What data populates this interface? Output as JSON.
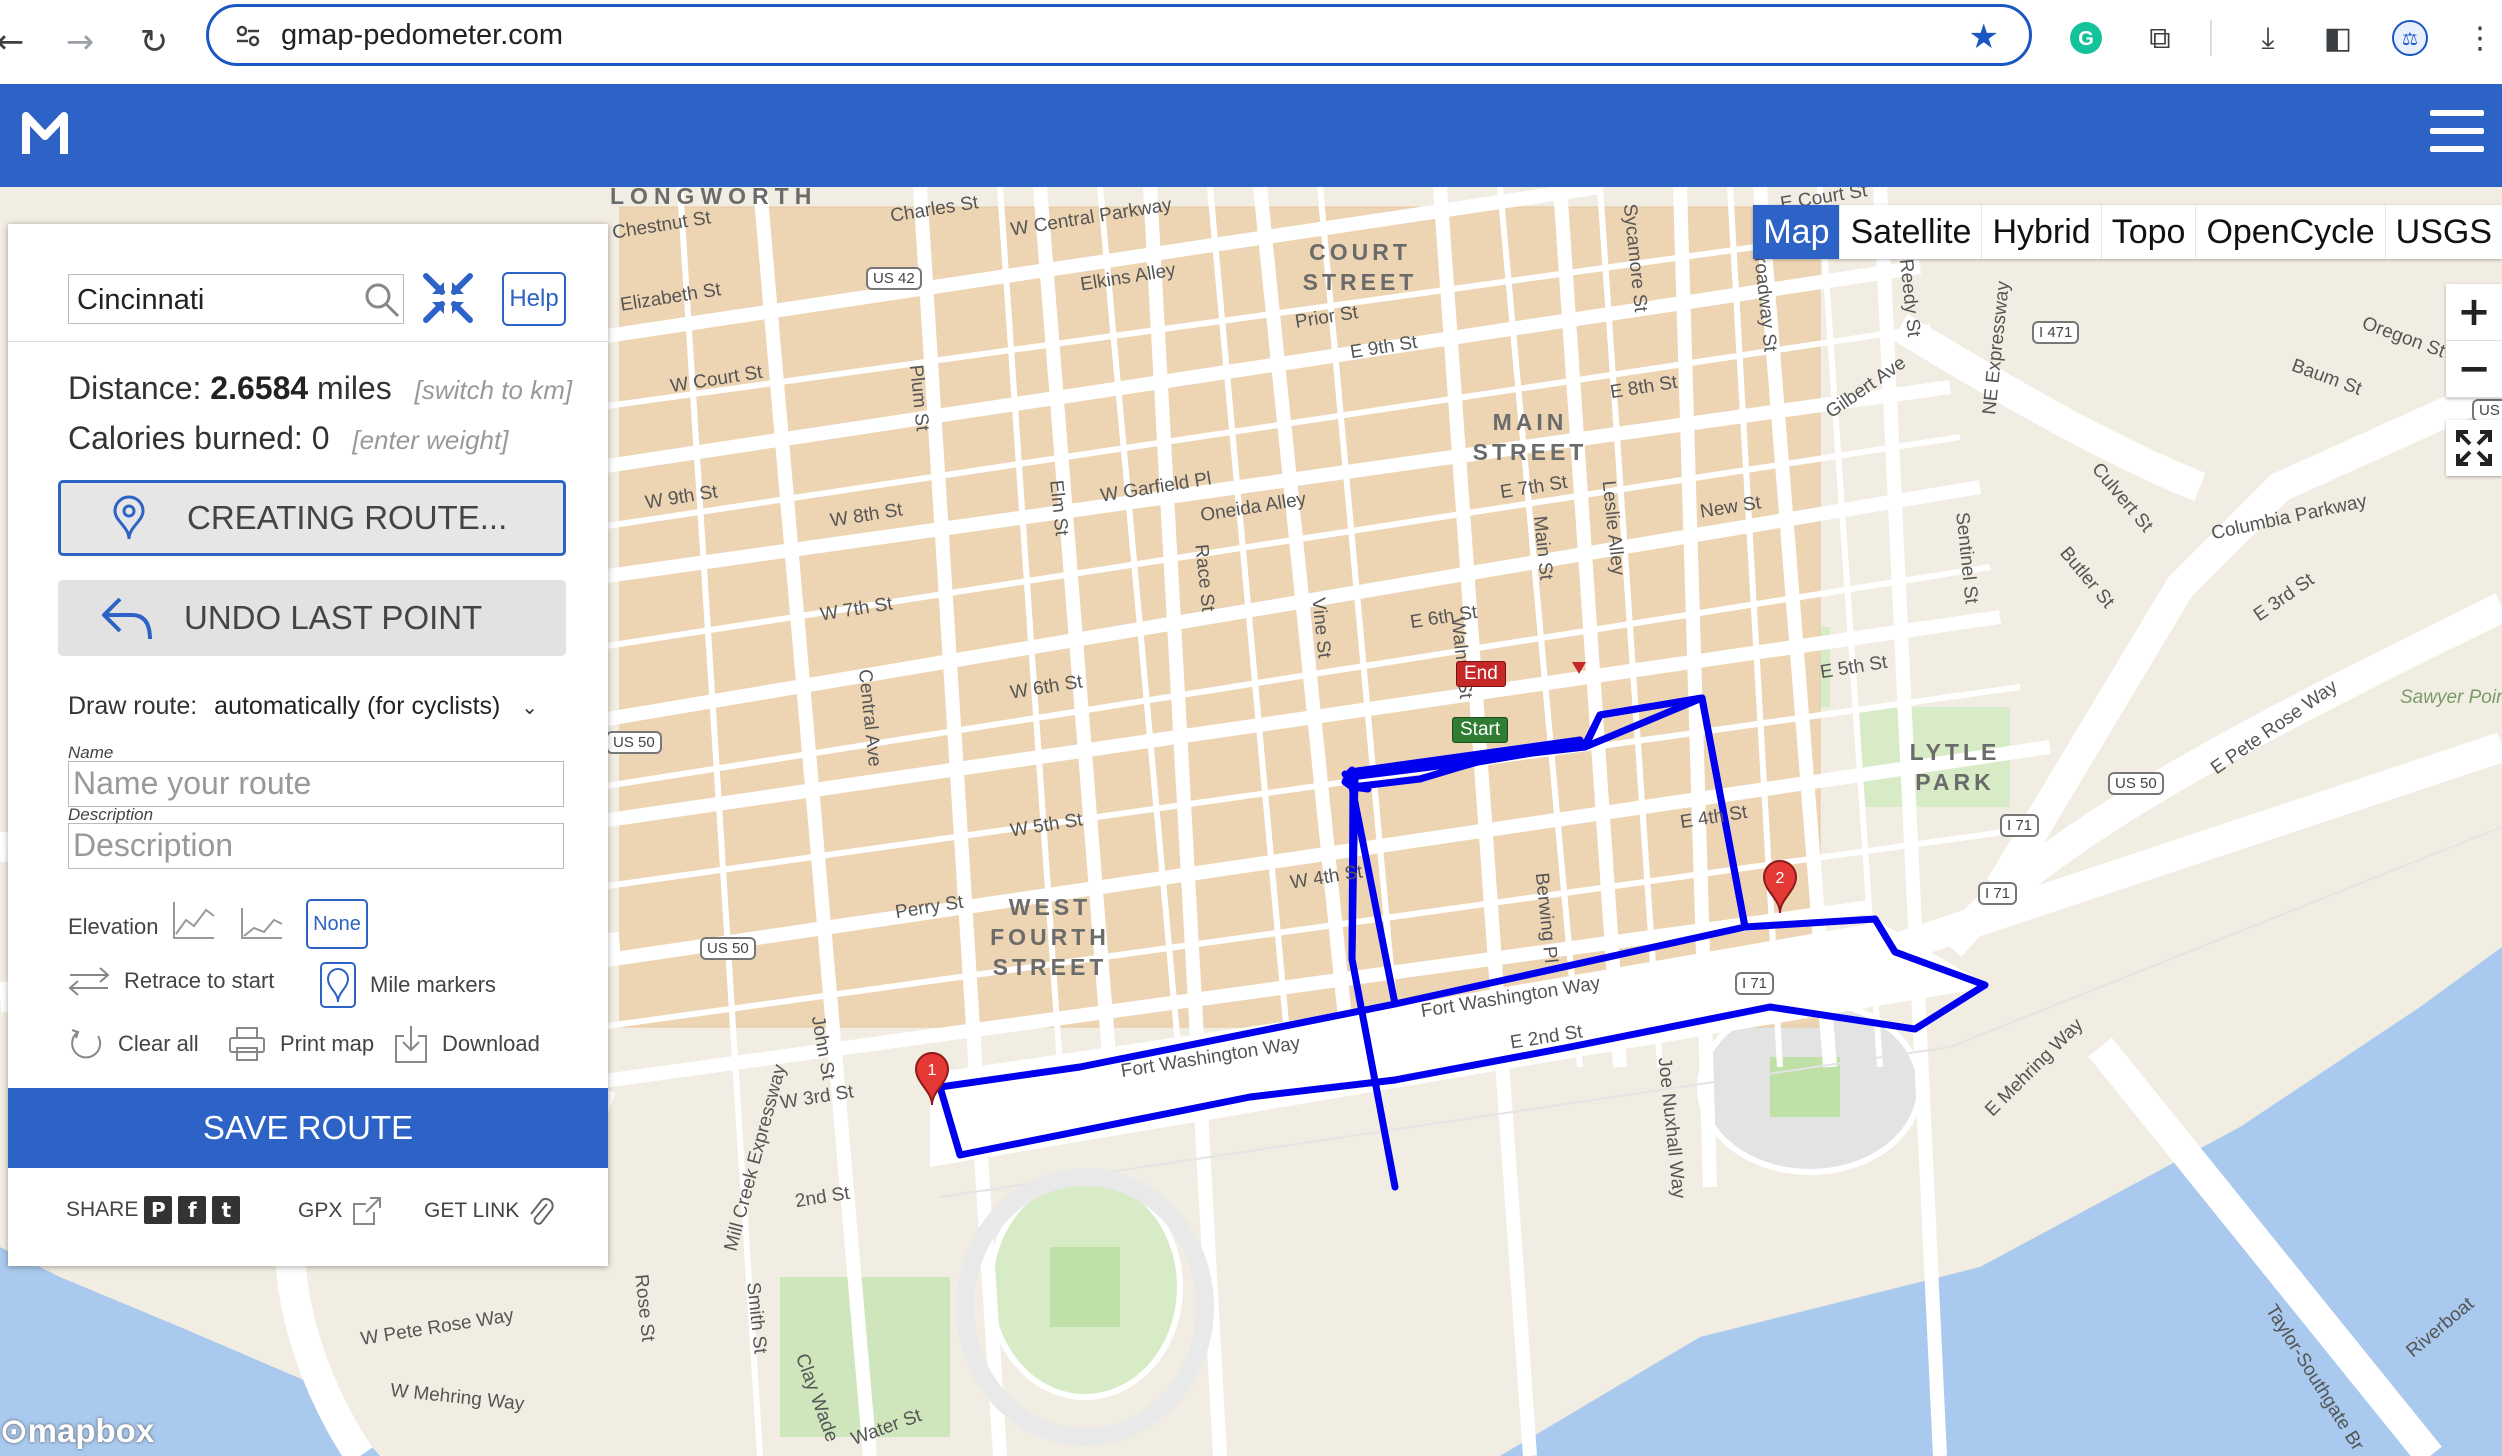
{
  "browser": {
    "url": "gmap-pedometer.com",
    "back_icon": "back-arrow-icon",
    "forward_icon": "forward-arrow-icon",
    "reload_icon": "reload-icon",
    "bookmark_icon": "star-icon"
  },
  "map": {
    "types": [
      "Map",
      "Satellite",
      "Hybrid",
      "Topo",
      "OpenCycle",
      "USGS"
    ],
    "active_type": "Map",
    "zoom_in": "+",
    "zoom_out": "−",
    "attribution": "mapbox",
    "route_color": "#0000ee",
    "markers": {
      "start": "Start",
      "end": "End",
      "mile1": "1",
      "mile2": "2"
    },
    "labels": {
      "streets": [
        "W Central Parkway",
        "Chestnut St",
        "Charles St",
        "Elizabeth St",
        "W Court St",
        "W 9th St",
        "W 8th St",
        "W 7th St",
        "W 6th St",
        "W 5th St",
        "W 4th St",
        "W 3rd St",
        "2nd St",
        "W Pete Rose Way",
        "W Mehring Way",
        "Fort Washington Way",
        "Central Ave",
        "Plum St",
        "Elm St",
        "Race St",
        "Vine St",
        "Walnut St",
        "Main St",
        "Sycamore St",
        "Broadway St",
        "E 9th St",
        "E 8th St",
        "E 7th St",
        "E 6th St",
        "E 5th St",
        "E 4th St",
        "E 3rd St",
        "E 2nd St",
        "New St",
        "Gilbert Ave",
        "Columbia Parkway",
        "E Pete Rose Way",
        "E Mehring Way",
        "Mill Creek Expressway",
        "Taylor-Southgate Br",
        "Riverboat",
        "Sawyer Point Park",
        "Oregon St",
        "Baum St",
        "W Garfield Pl",
        "Oneida Alley",
        "Elkins Alley",
        "Prior St",
        "Perry St",
        "John St",
        "Joe Nuxhall Way",
        "Berwing Pl",
        "Leslie Alley",
        "Culvert St",
        "Butler St",
        "Sentinel St",
        "NE Expressway",
        "Reedy St",
        "E Court St",
        "Water St",
        "Smith St",
        "Clay Wade",
        "Rose St"
      ],
      "areas": [
        "COURT STREET",
        "MAIN STREET",
        "WEST FOURTH STREET",
        "LYTLE PARK",
        "LONGWORTH"
      ],
      "shields": [
        "US 42",
        "US 50",
        "US 50",
        "I 471",
        "I 71",
        "I 71",
        "I 71",
        "US"
      ]
    }
  },
  "panel": {
    "search_value": "Cincinnati",
    "help_label": "Help",
    "distance_label": "Distance:",
    "distance_value": "2.6584",
    "distance_unit": "miles",
    "switch_unit": "[switch to km]",
    "calories_label": "Calories burned:",
    "calories_value": "0",
    "enter_weight": "[enter weight]",
    "creating_route_label": "CREATING ROUTE...",
    "undo_label": "UNDO LAST POINT",
    "draw_route_label": "Draw route:",
    "draw_route_value": "automatically (for cyclists)",
    "name_label": "Name",
    "name_placeholder": "Name your route",
    "description_label": "Description",
    "description_placeholder": "Description",
    "elevation_label": "Elevation",
    "elevation_none": "None",
    "retrace_label": "Retrace to start",
    "mile_markers_label": "Mile markers",
    "clear_label": "Clear all",
    "print_label": "Print map",
    "download_label": "Download",
    "save_label": "SAVE ROUTE",
    "share_label": "SHARE",
    "gpx_label": "GPX",
    "get_link_label": "GET LINK",
    "accent_color": "#2d62c6"
  }
}
